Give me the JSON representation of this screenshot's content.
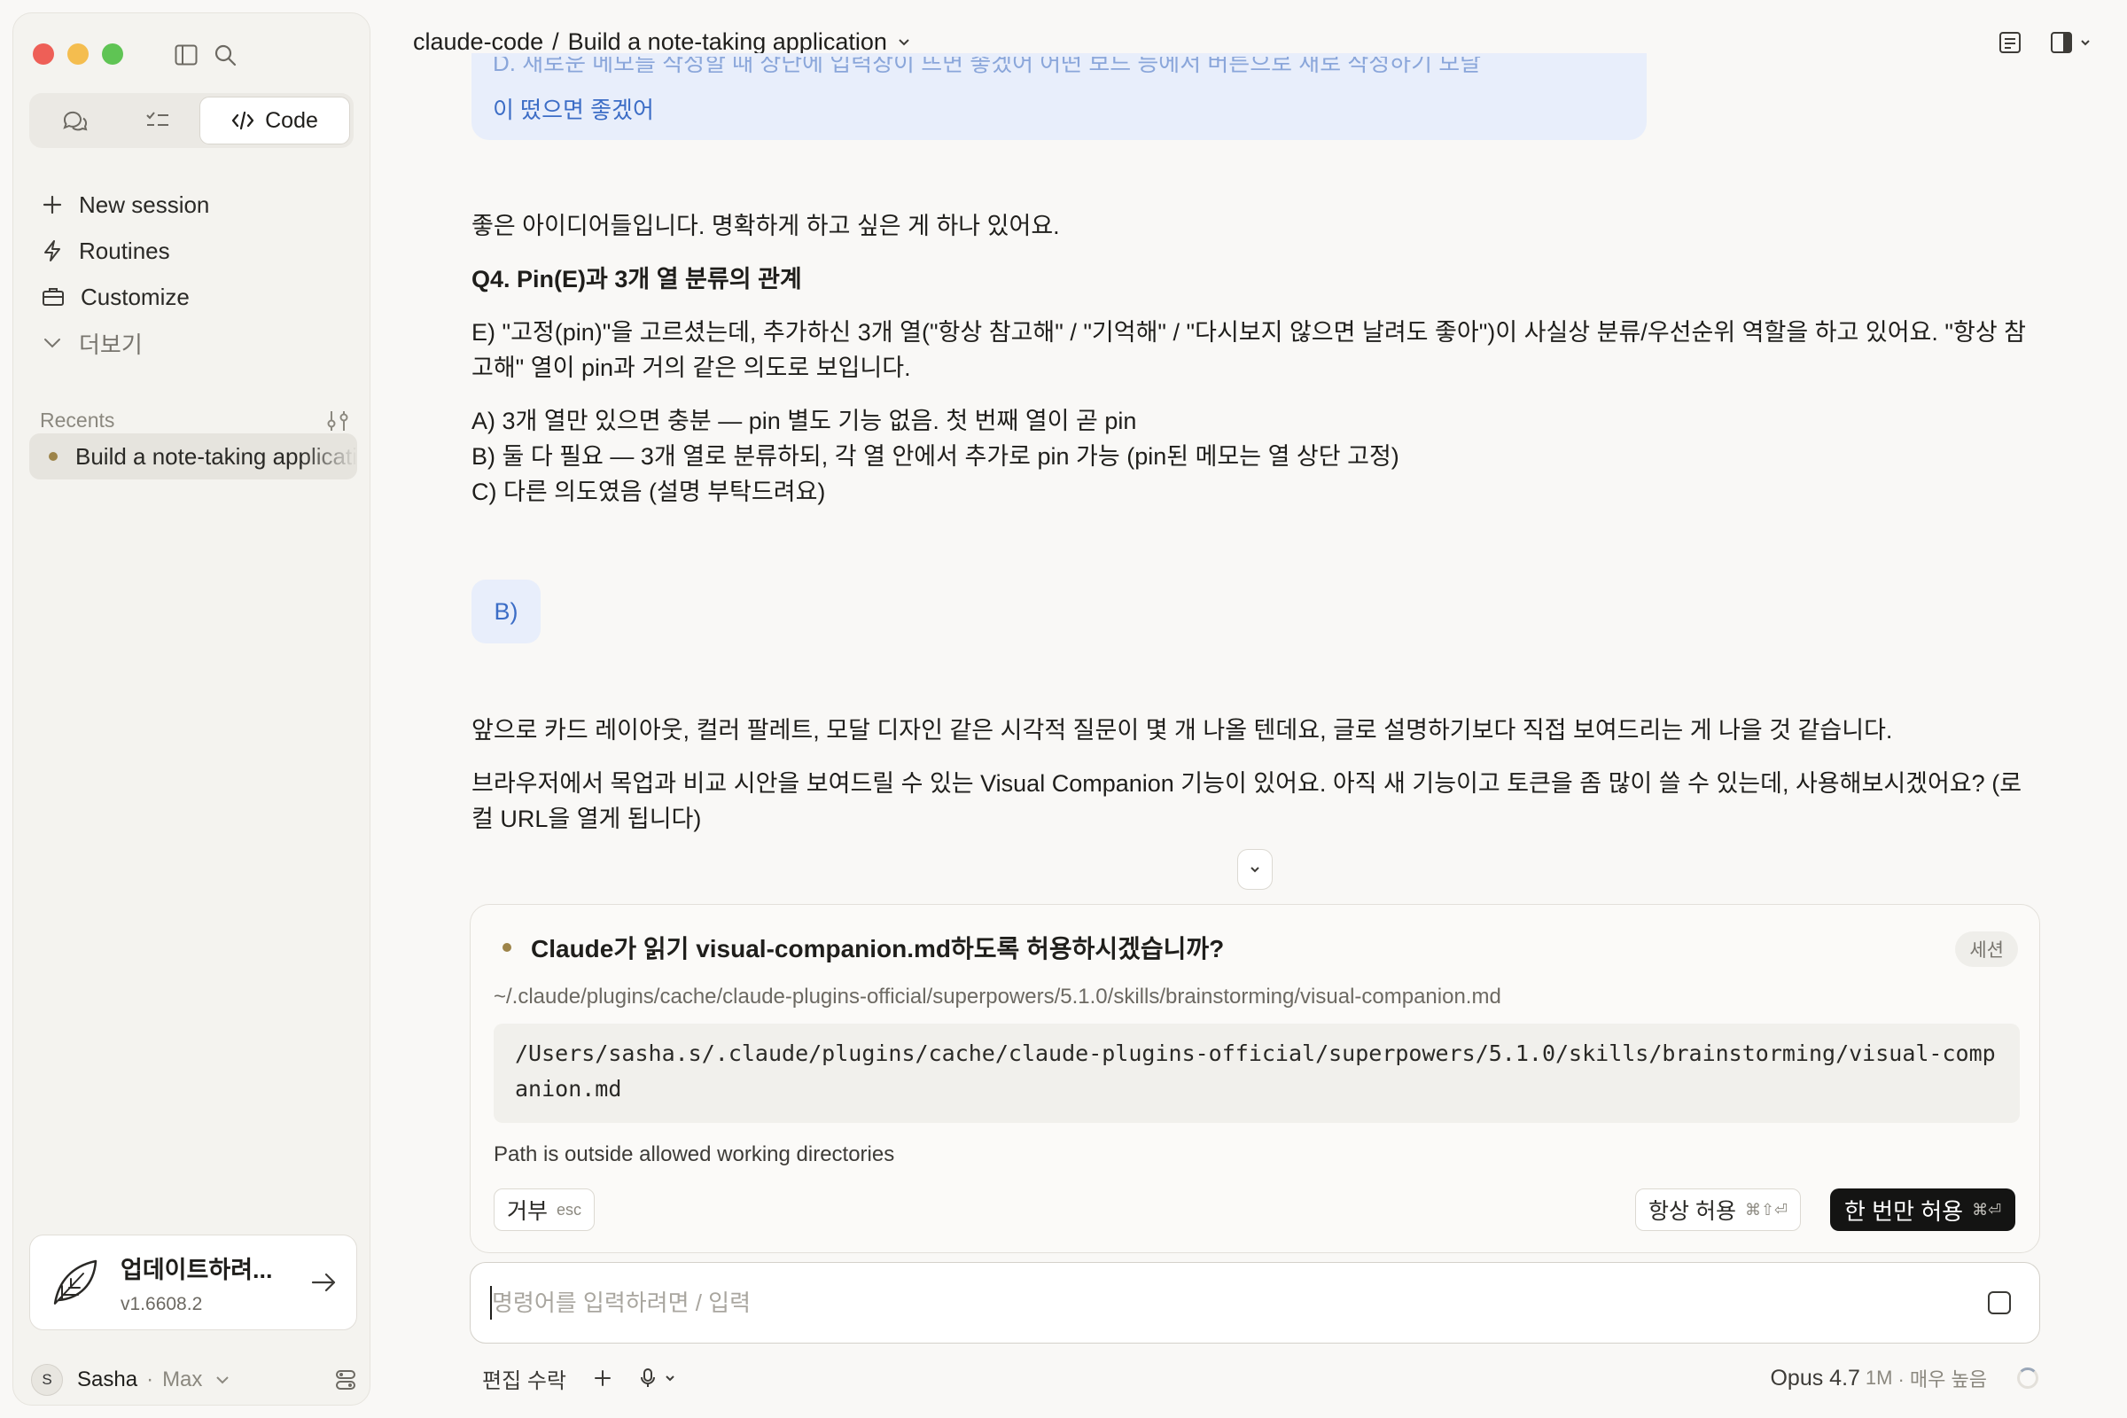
{
  "window": {
    "breadcrumb_project": "claude-code",
    "breadcrumb_sep": "/",
    "breadcrumb_session": "Build a note-taking application"
  },
  "sidebar": {
    "mode_code_label": "Code",
    "nav": {
      "new_session": "New session",
      "routines": "Routines",
      "customize": "Customize",
      "more": "더보기"
    },
    "recents_label": "Recents",
    "recent_items": [
      {
        "label": "Build a note-taking application"
      }
    ],
    "update": {
      "title": "업데이트하려...",
      "version": "v1.6608.2"
    },
    "user": {
      "initial": "S",
      "name": "Sasha",
      "sep": "·",
      "plan": "Max"
    }
  },
  "conversation": {
    "prev_user_clipped": "D. 새로운 메모를 작성할 때 상단에 입력창이 뜨면 좋겠어 어떤 보드 등에서 버튼으로 새로 작성하기 모달",
    "prev_user_tail": "이 떴으면 좋겠어",
    "assistant_1": {
      "intro": "좋은 아이디어들입니다. 명확하게 하고 싶은 게 하나 있어요.",
      "question_title": "Q4. Pin(E)과 3개 열 분류의 관계",
      "question_body": "E) \"고정(pin)\"을 고르셨는데, 추가하신 3개 열(\"항상 참고해\" / \"기억해\" / \"다시보지 않으면 날려도 좋아\")이 사실상 분류/우선순위 역할을 하고 있어요. \"항상 참고해\" 열이 pin과 거의 같은 의도로 보입니다.",
      "option_a": "A) 3개 열만 있으면 충분 — pin 별도 기능 없음. 첫 번째 열이 곧 pin",
      "option_b": "B) 둘 다 필요 — 3개 열로 분류하되, 각 열 안에서 추가로 pin 가능 (pin된 메모는 열 상단 고정)",
      "option_c": "C) 다른 의도였음 (설명 부탁드려요)"
    },
    "user_reply": "B)",
    "assistant_2": {
      "p1": "앞으로 카드 레이아웃, 컬러 팔레트, 모달 디자인 같은 시각적 질문이 몇 개 나올 텐데요, 글로 설명하기보다 직접 보여드리는 게 나을 것 같습니다.",
      "p2": "브라우저에서 목업과 비교 시안을 보여드릴 수 있는 Visual Companion 기능이 있어요. 아직 새 기능이고 토큰을 좀 많이 쓸 수 있는데, 사용해보시겠어요? (로컬 URL을 열게 됩니다)"
    }
  },
  "permission": {
    "title": "Claude가 읽기 visual-companion.md하도록 허용하시겠습니까?",
    "badge": "세션",
    "short_path": "~/.claude/plugins/cache/claude-plugins-official/superpowers/5.1.0/skills/brainstorming/visual-companion.md",
    "full_path": "/Users/sasha.s/.claude/plugins/cache/claude-plugins-official/superpowers/5.1.0/skills/brainstorming/visual-companion.md",
    "note": "Path is outside allowed working directories",
    "deny_label": "거부",
    "deny_key": "esc",
    "always_label": "항상 허용",
    "always_key": "⌘⇧⏎",
    "once_label": "한 번만 허용",
    "once_key": "⌘⏎"
  },
  "composer": {
    "placeholder": "명령어를 입력하려면 / 입력",
    "value": ""
  },
  "bottom": {
    "accept_edits": "편집 수락",
    "model_name": "Opus 4.7",
    "model_context": "1M",
    "model_effort": "· 매우 높음"
  },
  "colors": {
    "accent_user_bubble": "#e8eefb",
    "user_text": "#3c6dc6",
    "status_dot": "#9d8449",
    "primary_button": "#141413"
  }
}
